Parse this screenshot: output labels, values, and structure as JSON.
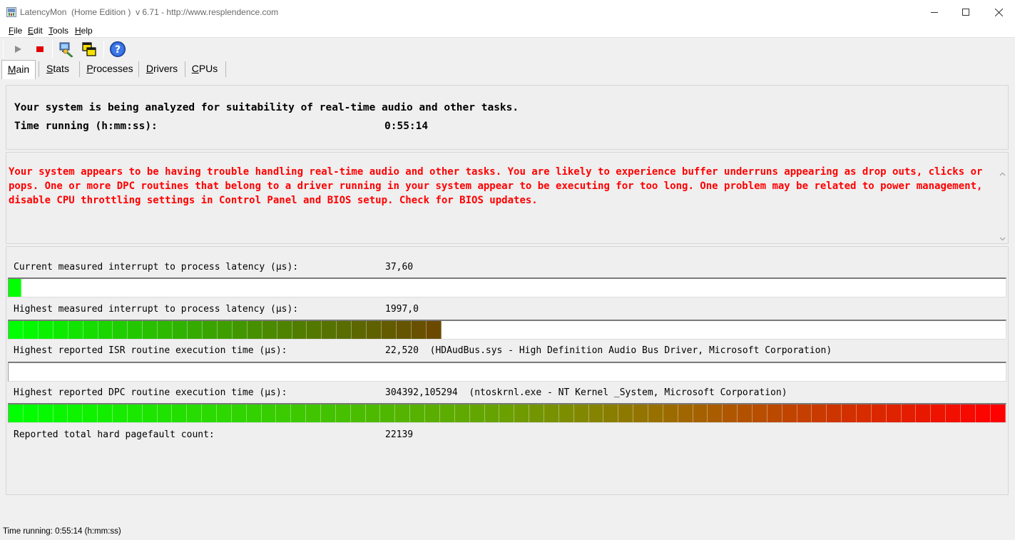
{
  "window": {
    "title": "LatencyMon  (Home Edition )  v 6.71 - http://www.resplendence.com",
    "app_icon": "latencymon-app-icon",
    "controls": [
      "minimize-icon",
      "maximize-icon",
      "close-icon"
    ]
  },
  "menu": {
    "file": {
      "u": "F",
      "rest": "ile"
    },
    "edit": {
      "u": "E",
      "rest": "dit"
    },
    "tools": {
      "u": "T",
      "rest": "ools"
    },
    "help": {
      "u": "H",
      "rest": "elp"
    }
  },
  "toolbar": {
    "buttons": [
      "play-icon",
      "stop-icon",
      "system-info-icon",
      "windows-icon",
      "help-icon"
    ]
  },
  "tabs": {
    "main": {
      "u": "M",
      "rest": "ain"
    },
    "stats": {
      "u": "S",
      "rest": "tats"
    },
    "processes": {
      "u": "P",
      "rest": "rocesses"
    },
    "drivers": {
      "u": "D",
      "rest": "rivers"
    },
    "cpus": {
      "u": "C",
      "rest": "PUs"
    },
    "active": "main"
  },
  "header": {
    "analysis_line": "Your system is being analyzed for suitability of real-time audio and other tasks.",
    "time_label": "Time running (h:mm:ss):",
    "time_value": "0:55:14"
  },
  "warning": {
    "text": "Your system appears to be having trouble handling real-time audio and other tasks. You are likely to experience buffer underruns appearing as drop outs, clicks or pops. One or more DPC routines that belong to a driver running in your system appear to be executing for too long. One problem may be related to power management, disable CPU throttling settings in Control Panel and BIOS setup. Check for BIOS updates.",
    "color": "#ff0000"
  },
  "metrics": {
    "current_latency": {
      "label": "Current measured interrupt to process latency (µs):",
      "value": "37,60",
      "bar_fraction": 0.013
    },
    "highest_latency": {
      "label": "Highest measured interrupt to process latency (µs):",
      "value": "1997,0",
      "bar_fraction": 0.434
    },
    "highest_isr": {
      "label": "Highest reported ISR routine execution time (µs):",
      "value": "22,520",
      "detail": "(HDAudBus.sys - High Definition Audio Bus Driver, Microsoft Corporation)",
      "bar_fraction": 0.0
    },
    "highest_dpc": {
      "label": "Highest reported DPC routine execution time (µs):",
      "value": "304392,105294",
      "detail": "(ntoskrnl.exe - NT Kernel _System, Microsoft Corporation)",
      "bar_fraction": 1.0
    },
    "pagefaults": {
      "label": "Reported total hard pagefault count:",
      "value": "22139"
    }
  },
  "colors": {
    "meter_start": "#00ff00",
    "meter_mid": "#4a8a00",
    "meter_brown": "#6b4a00",
    "meter_end": "#ff0000"
  },
  "status": {
    "text": "Time running: 0:55:14  (h:mm:ss)"
  }
}
